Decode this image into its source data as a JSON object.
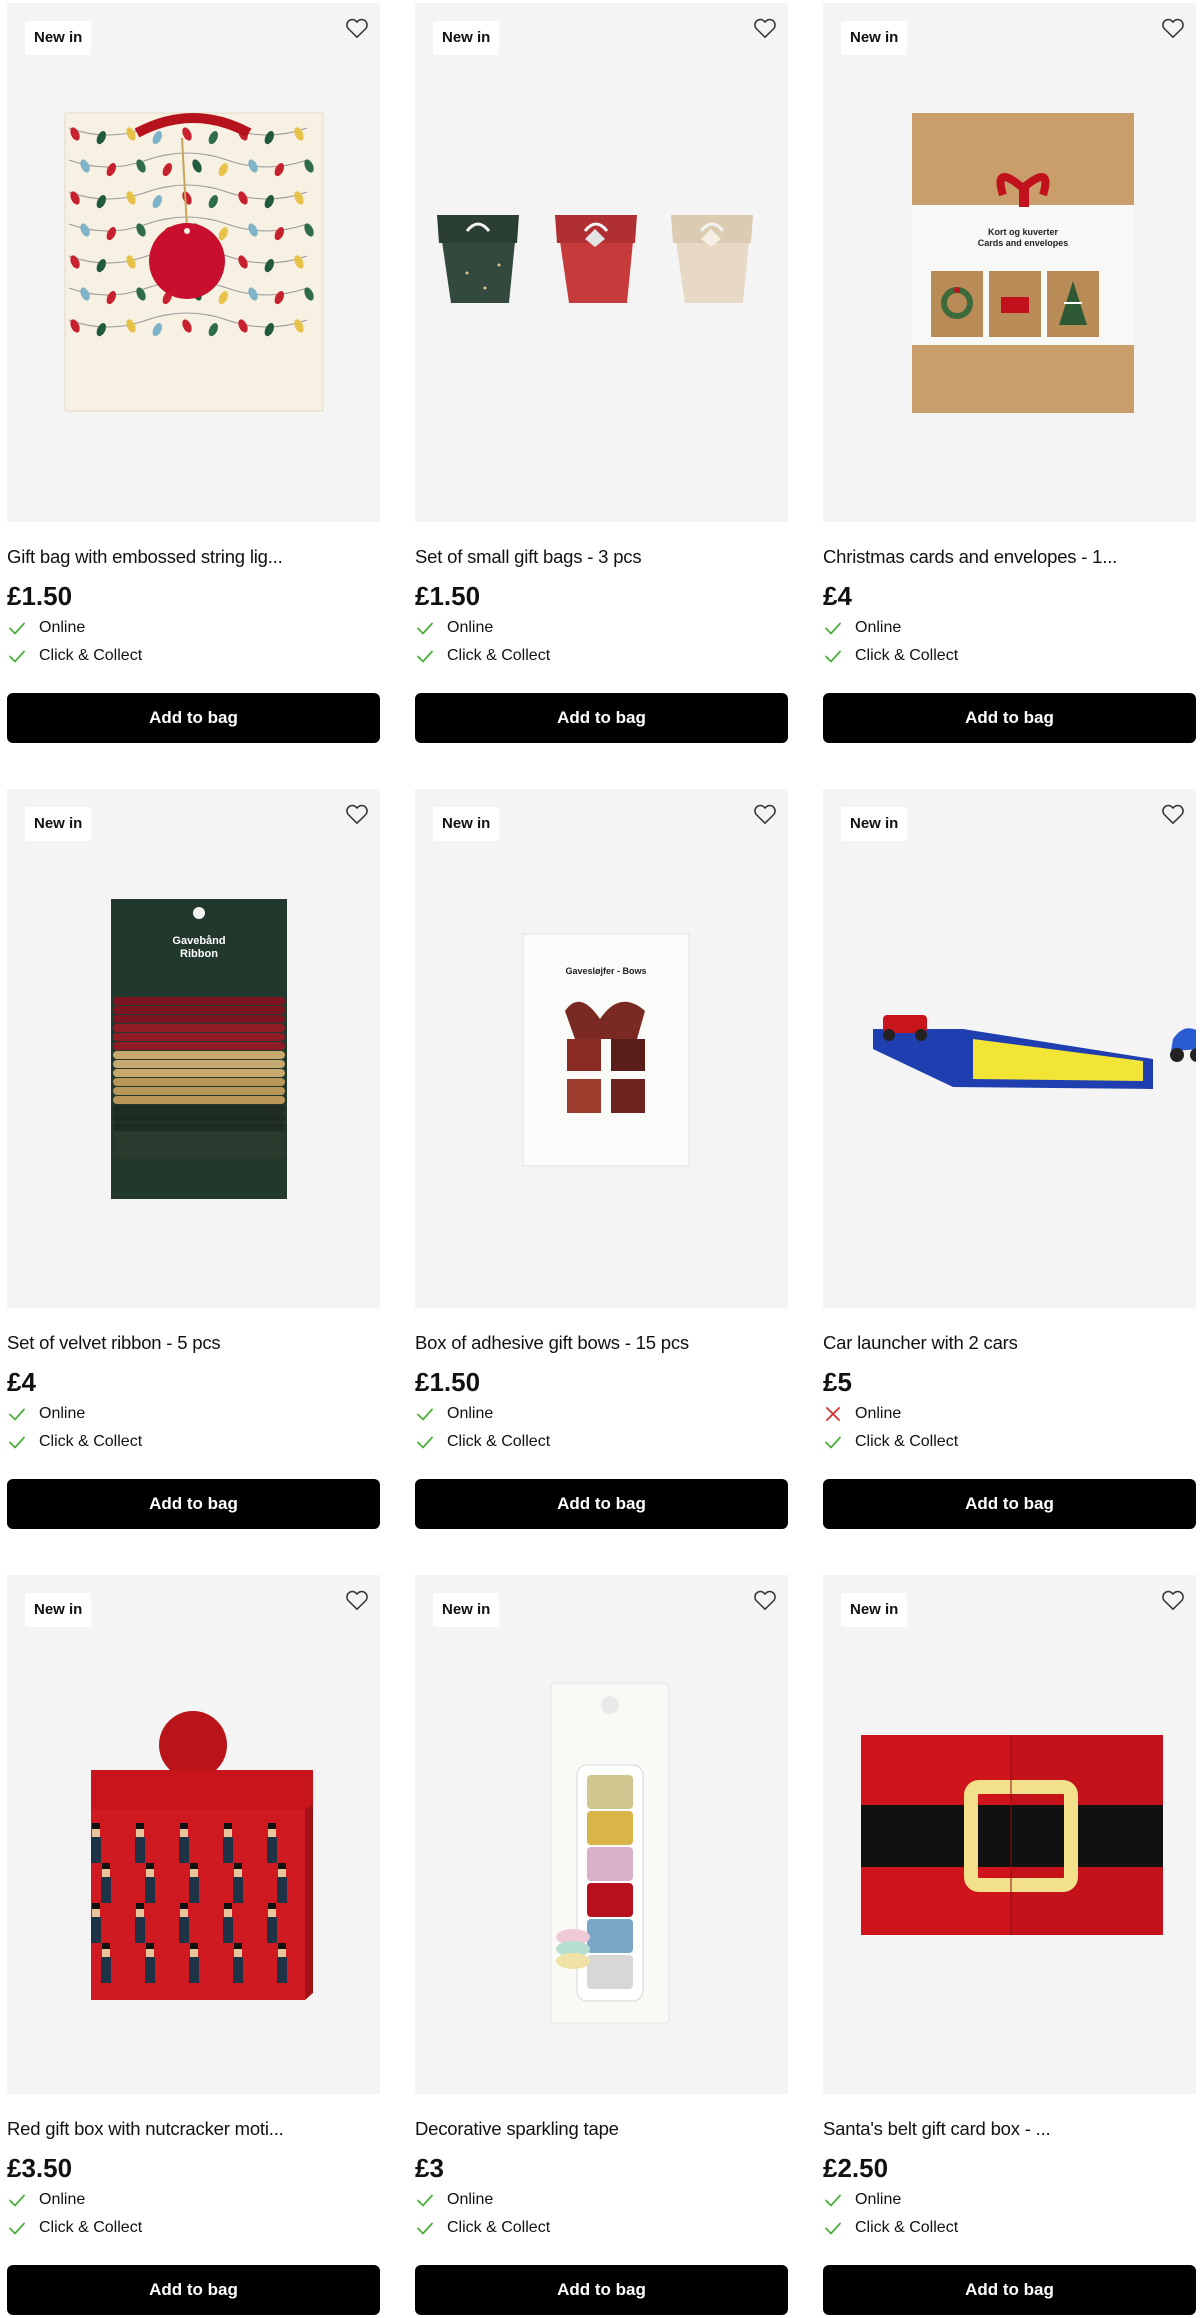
{
  "products": [
    {
      "badge": "New in",
      "name": "Gift bag with embossed string lig...",
      "price": "£1.50",
      "availability": [
        {
          "label": "Online",
          "available": true
        },
        {
          "label": "Click & Collect",
          "available": true
        }
      ],
      "button": "Add to bag",
      "image_icon": "gift-bag-string-lights"
    },
    {
      "badge": "New in",
      "name": "Set of small gift bags - 3 pcs",
      "price": "£1.50",
      "availability": [
        {
          "label": "Online",
          "available": true
        },
        {
          "label": "Click & Collect",
          "available": true
        }
      ],
      "button": "Add to bag",
      "image_icon": "small-gift-bags"
    },
    {
      "badge": "New in",
      "name": "Christmas cards and envelopes - 1...",
      "price": "£4",
      "availability": [
        {
          "label": "Online",
          "available": true
        },
        {
          "label": "Click & Collect",
          "available": true
        }
      ],
      "button": "Add to bag",
      "image_icon": "christmas-cards-pack",
      "packaging_text": [
        "Kort og kuverter",
        "Cards and envelopes"
      ]
    },
    {
      "badge": "New in",
      "name": "Set of velvet ribbon - 5 pcs",
      "price": "£4",
      "availability": [
        {
          "label": "Online",
          "available": true
        },
        {
          "label": "Click & Collect",
          "available": true
        }
      ],
      "button": "Add to bag",
      "image_icon": "velvet-ribbon-card",
      "packaging_text": [
        "Gavebånd",
        "Ribbon"
      ]
    },
    {
      "badge": "New in",
      "name": "Box of adhesive gift bows - 15 pcs",
      "price": "£1.50",
      "availability": [
        {
          "label": "Online",
          "available": true
        },
        {
          "label": "Click & Collect",
          "available": true
        }
      ],
      "button": "Add to bag",
      "image_icon": "gift-bows-pack",
      "packaging_text": [
        "Gavesløjfer - Bows"
      ]
    },
    {
      "badge": "New in",
      "name": "Car launcher with 2 cars",
      "price": "£5",
      "availability": [
        {
          "label": "Online",
          "available": false
        },
        {
          "label": "Click & Collect",
          "available": true
        }
      ],
      "button": "Add to bag",
      "image_icon": "car-launcher"
    },
    {
      "badge": "New in",
      "name": "Red gift box with nutcracker moti...",
      "price": "£3.50",
      "availability": [
        {
          "label": "Online",
          "available": true
        },
        {
          "label": "Click & Collect",
          "available": true
        }
      ],
      "button": "Add to bag",
      "image_icon": "nutcracker-gift-box"
    },
    {
      "badge": "New in",
      "name": "Decorative sparkling tape",
      "price": "£3",
      "availability": [
        {
          "label": "Online",
          "available": true
        },
        {
          "label": "Click & Collect",
          "available": true
        }
      ],
      "button": "Add to bag",
      "image_icon": "sparkling-tape"
    },
    {
      "badge": "New in",
      "name": "Santa's belt gift card box - ...",
      "price": "£2.50",
      "availability": [
        {
          "label": "Online",
          "available": true
        },
        {
          "label": "Click & Collect",
          "available": true
        }
      ],
      "button": "Add to bag",
      "image_icon": "santa-belt-box"
    }
  ],
  "colors": {
    "check": "#4caf3c",
    "cross": "#d32f2f",
    "button_bg": "#000000",
    "image_bg": "#f4f4f4"
  }
}
